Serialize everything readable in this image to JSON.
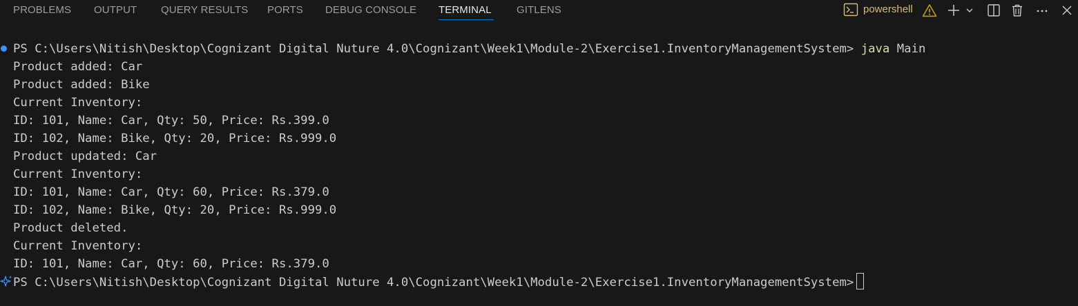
{
  "tabs": [
    {
      "label": "PROBLEMS"
    },
    {
      "label": "OUTPUT"
    },
    {
      "label": "QUERY RESULTS"
    },
    {
      "label": "PORTS"
    },
    {
      "label": "DEBUG CONSOLE"
    },
    {
      "label": "TERMINAL",
      "active": true
    },
    {
      "label": "GITLENS"
    }
  ],
  "toolbar": {
    "shell_icon": "terminal-powershell-icon",
    "shell_name": "powershell",
    "warning_icon": "warning-icon",
    "new_terminal_icon": "plus-icon",
    "dropdown_icon": "chevron-down-icon",
    "split_icon": "split-terminal-icon",
    "kill_icon": "trash-icon",
    "more_icon": "ellipsis-icon",
    "close_icon": "close-icon"
  },
  "terminal": {
    "prompt": "PS C:\\Users\\Nitish\\Desktop\\Cognizant Digital Nuture 4.0\\Cognizant\\Week1\\Module-2\\Exercise1.InventoryManagementSystem>",
    "command_keyword": "java",
    "command_arg": "Main",
    "output": [
      "Product added: Car",
      "Product added: Bike",
      "Current Inventory:",
      "ID: 101, Name: Car, Qty: 50, Price: Rs.399.0",
      "ID: 102, Name: Bike, Qty: 20, Price: Rs.999.0",
      "Product updated: Car",
      "Current Inventory:",
      "ID: 101, Name: Car, Qty: 60, Price: Rs.379.0",
      "ID: 102, Name: Bike, Qty: 20, Price: Rs.999.0",
      "Product deleted.",
      "Current Inventory:",
      "ID: 101, Name: Car, Qty: 60, Price: Rs.379.0"
    ],
    "final_prompt": "PS C:\\Users\\Nitish\\Desktop\\Cognizant Digital Nuture 4.0\\Cognizant\\Week1\\Module-2\\Exercise1.InventoryManagementSystem>",
    "colors": {
      "background": "#181818",
      "text": "#cccccc",
      "command": "#dcdcaa",
      "accent": "#0078d4",
      "shell_name": "#d7ba7d",
      "warning": "#cca700",
      "success_marker": "#3794ff"
    }
  }
}
